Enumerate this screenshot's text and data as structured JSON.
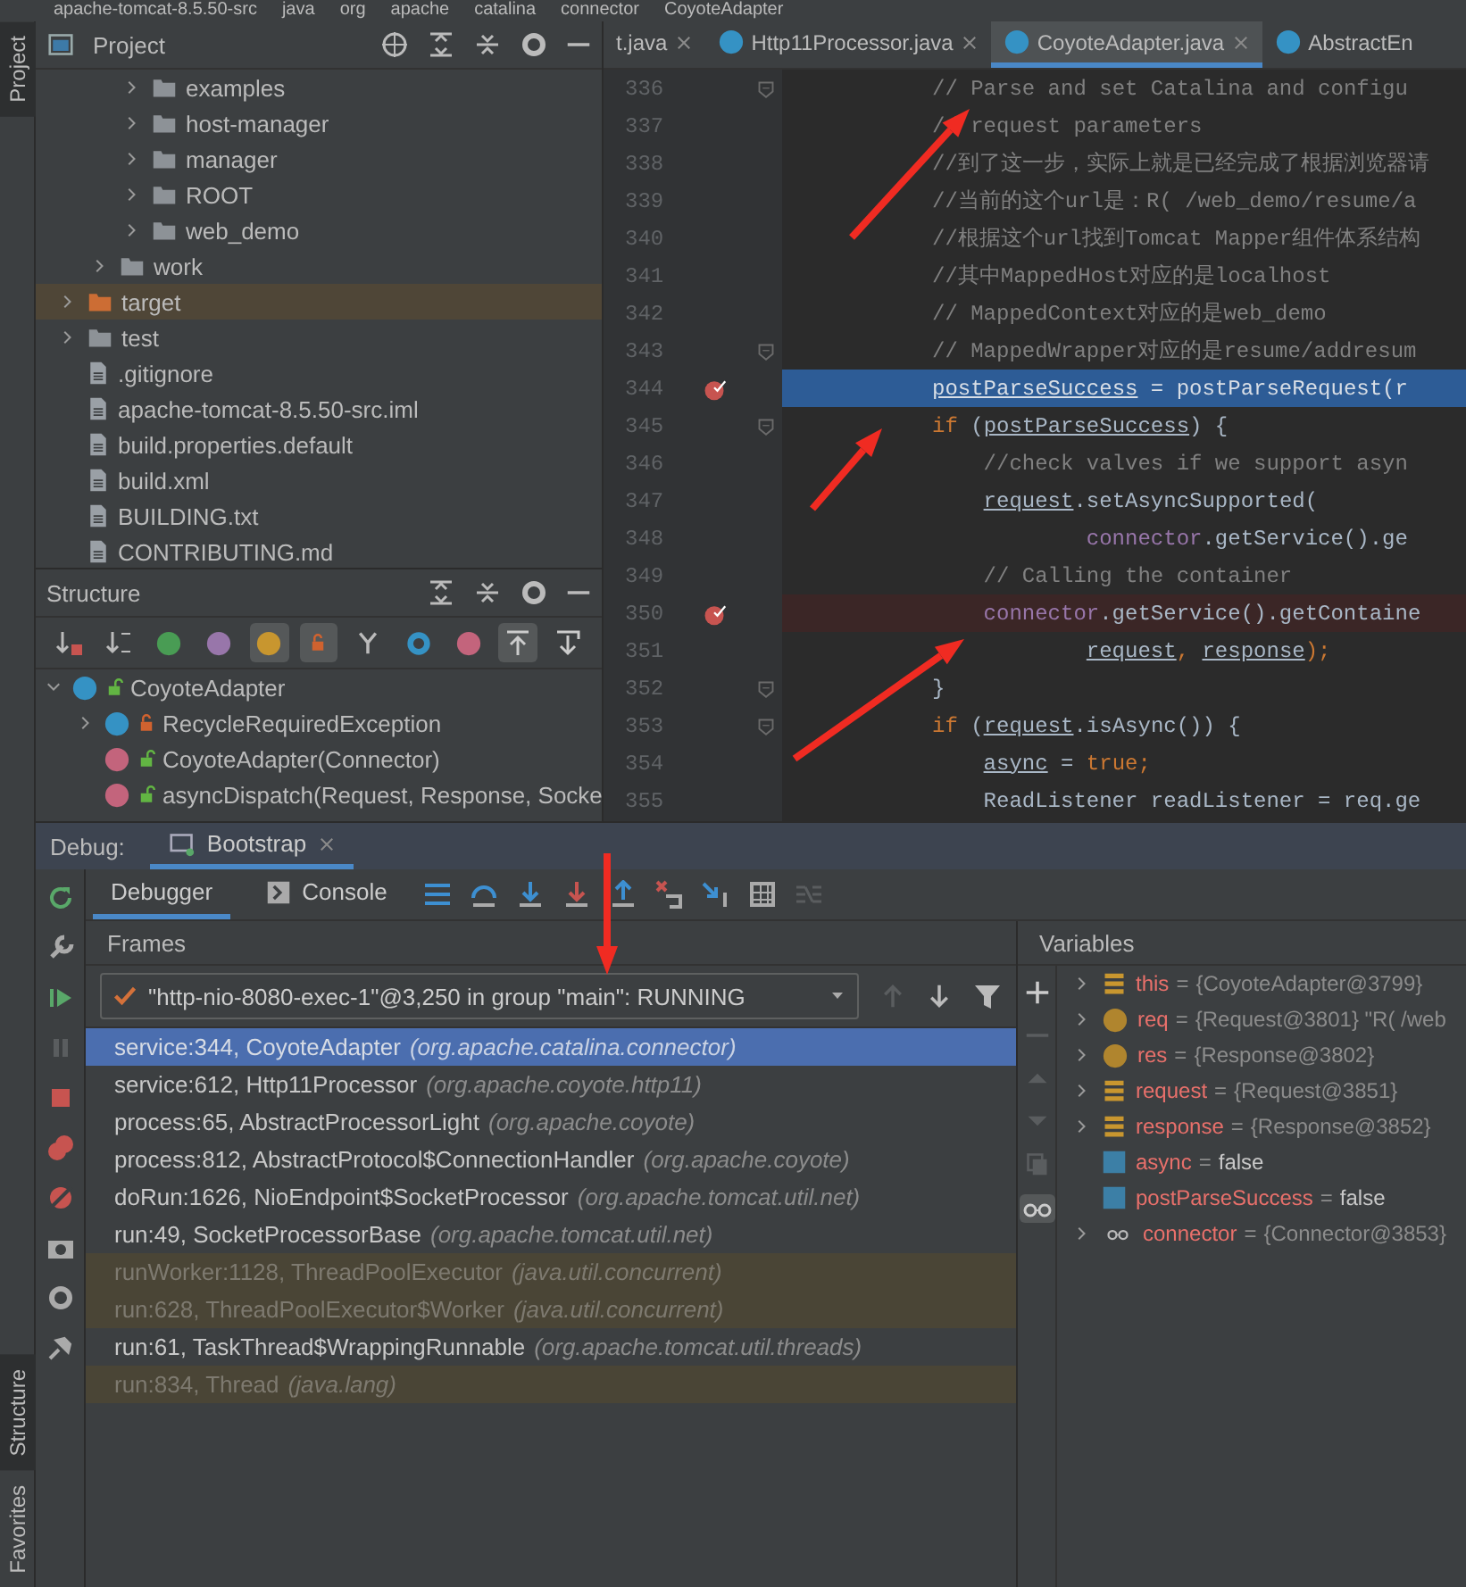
{
  "breadcrumb": [
    "apache-tomcat-8.5.50-src",
    "java",
    "org",
    "apache",
    "catalina",
    "connector",
    "CoyoteAdapter"
  ],
  "side_stripe": {
    "top": [
      {
        "label": "Project",
        "selected": true
      }
    ],
    "bottom": [
      {
        "label": "Structure",
        "selected": true
      },
      {
        "label": "Favorites",
        "selected": false
      }
    ]
  },
  "project": {
    "title": "Project",
    "tree": [
      {
        "children": [
          {
            "children": [
              {
                "label": "examples",
                "kind": "folder",
                "expanded": false,
                "highlighted": false
              },
              {
                "label": "host-manager",
                "kind": "folder",
                "expanded": false,
                "highlighted": false
              },
              {
                "label": "manager",
                "kind": "folder",
                "expanded": false,
                "highlighted": false
              },
              {
                "label": "ROOT",
                "kind": "folder",
                "expanded": false,
                "highlighted": false
              },
              {
                "label": "web_demo",
                "kind": "folder",
                "expanded": false,
                "highlighted": false
              }
            ]
          },
          {
            "label": "work",
            "kind": "folder",
            "expanded": false,
            "highlighted": false
          }
        ]
      },
      {
        "label": "target",
        "kind": "excluded-folder",
        "expanded": false,
        "highlighted": true
      },
      {
        "label": "test",
        "kind": "folder",
        "expanded": false,
        "highlighted": false
      },
      {
        "label": ".gitignore",
        "kind": "file",
        "highlighted": false
      },
      {
        "label": "apache-tomcat-8.5.50-src.iml",
        "kind": "file",
        "highlighted": false
      },
      {
        "label": "build.properties.default",
        "kind": "file",
        "highlighted": false
      },
      {
        "label": "build.xml",
        "kind": "file",
        "highlighted": false
      },
      {
        "label": "BUILDING.txt",
        "kind": "file",
        "highlighted": false
      },
      {
        "label": "CONTRIBUTING.md",
        "kind": "file",
        "highlighted": false
      }
    ]
  },
  "structure": {
    "title": "Structure",
    "toolbar": [
      {
        "kind": "sort-visibility",
        "on": false
      },
      {
        "kind": "sort-alpha",
        "on": false
      },
      {
        "kind": "inherited",
        "on": false
      },
      {
        "kind": "properties",
        "on": false
      },
      {
        "kind": "fields",
        "on": true
      },
      {
        "kind": "non-public",
        "on": true
      },
      {
        "kind": "anonymous",
        "on": false
      },
      {
        "kind": "lambdas",
        "on": false
      },
      {
        "kind": "lambda",
        "on": false
      },
      {
        "kind": "autoscroll-to",
        "on": true
      },
      {
        "kind": "autoscroll-from",
        "on": false
      }
    ],
    "tree": [
      {
        "label": "CoyoteAdapter",
        "kind": "class",
        "private": false,
        "expanded": true,
        "children": [
          {
            "label": "RecycleRequiredException",
            "kind": "class",
            "private": true,
            "expanded": false
          },
          {
            "label": "CoyoteAdapter(Connector)",
            "kind": "method",
            "private": false
          },
          {
            "label": "asyncDispatch(Request, Response, Socke",
            "kind": "method",
            "private": false
          }
        ]
      }
    ]
  },
  "editor": {
    "tabs": [
      {
        "label": "t.java",
        "selected": false,
        "icon": false,
        "closable": true
      },
      {
        "label": "Http11Processor.java",
        "selected": false,
        "icon": true,
        "closable": true
      },
      {
        "label": "CoyoteAdapter.java",
        "selected": true,
        "icon": true,
        "closable": true
      },
      {
        "label": "AbstractEn",
        "selected": false,
        "icon": true,
        "closable": false
      }
    ],
    "lines": [
      {
        "number": "336",
        "breakpoint": false,
        "current": false,
        "fold_marker": true,
        "tokens": [
          {
            "kind": "comment",
            "text": "// Parse and set Catalina and configu"
          }
        ]
      },
      {
        "number": "337",
        "breakpoint": false,
        "current": false,
        "fold_marker": false,
        "tokens": [
          {
            "kind": "comment",
            "text": "// request parameters"
          }
        ]
      },
      {
        "number": "338",
        "breakpoint": false,
        "current": false,
        "fold_marker": false,
        "tokens": [
          {
            "kind": "comment",
            "text": "//到了这一步，实际上就是已经完成了根据浏览器请"
          }
        ]
      },
      {
        "number": "339",
        "breakpoint": false,
        "current": false,
        "fold_marker": false,
        "tokens": [
          {
            "kind": "comment",
            "text": "//当前的这个url是：R( /web_demo/resume/a"
          }
        ]
      },
      {
        "number": "340",
        "breakpoint": false,
        "current": false,
        "fold_marker": false,
        "tokens": [
          {
            "kind": "comment",
            "text": "//根据这个url找到Tomcat Mapper组件体系结构"
          }
        ]
      },
      {
        "number": "341",
        "breakpoint": false,
        "current": false,
        "fold_marker": false,
        "tokens": [
          {
            "kind": "comment",
            "text": "//其中MappedHost对应的是localhost"
          }
        ]
      },
      {
        "number": "342",
        "breakpoint": false,
        "current": false,
        "fold_marker": false,
        "tokens": [
          {
            "kind": "comment",
            "text": "// MappedContext对应的是web_demo"
          }
        ]
      },
      {
        "number": "343",
        "breakpoint": false,
        "current": false,
        "fold_marker": true,
        "tokens": [
          {
            "kind": "comment",
            "text": "// MappedWrapper对应的是resume/addresum"
          }
        ]
      },
      {
        "number": "344",
        "breakpoint": true,
        "current": true,
        "fold_marker": false,
        "tokens": [
          {
            "kind": "var",
            "text": "postParseSuccess"
          },
          {
            "kind": "plain",
            "text": " = postParseRequest(r"
          }
        ]
      },
      {
        "number": "345",
        "breakpoint": false,
        "current": false,
        "fold_marker": true,
        "tokens": [
          {
            "kind": "keyword",
            "text": "if"
          },
          {
            "kind": "plain",
            "text": " ("
          },
          {
            "kind": "var",
            "text": "postParseSuccess"
          },
          {
            "kind": "plain",
            "text": ") {"
          }
        ],
        "children": [
          {
            "number": "346",
            "kind": "statement",
            "breakpoint": false,
            "current": false,
            "fold_marker": false,
            "tokens": [
              {
                "kind": "comment",
                "text": "//check valves if we support asyn"
              }
            ]
          },
          {
            "number": "347",
            "kind": "statement",
            "breakpoint": false,
            "current": false,
            "fold_marker": false,
            "tokens": [
              {
                "kind": "var",
                "text": "request"
              },
              {
                "kind": "plain",
                "text": ".setAsyncSupported("
              }
            ],
            "children": [
              {
                "number": "348",
                "kind": "continuation",
                "breakpoint": false,
                "current": false,
                "fold_marker": false,
                "tokens": [
                  {
                    "kind": "field",
                    "text": "connector"
                  },
                  {
                    "kind": "plain",
                    "text": ".getService().ge"
                  }
                ]
              }
            ]
          },
          {
            "number": "349",
            "kind": "statement",
            "breakpoint": false,
            "current": false,
            "fold_marker": false,
            "tokens": [
              {
                "kind": "comment",
                "text": "// Calling the container"
              }
            ]
          },
          {
            "number": "350",
            "kind": "statement",
            "breakpoint": true,
            "current": false,
            "fold_marker": false,
            "tokens": [
              {
                "kind": "field",
                "text": "connector"
              },
              {
                "kind": "plain",
                "text": ".getService().getContaine"
              }
            ],
            "children": [
              {
                "number": "351",
                "kind": "continuation",
                "breakpoint": false,
                "current": false,
                "fold_marker": false,
                "tokens": [
                  {
                    "kind": "var",
                    "text": "request"
                  },
                  {
                    "kind": "punct",
                    "text": ", "
                  },
                  {
                    "kind": "var",
                    "text": "response"
                  },
                  {
                    "kind": "punct",
                    "text": ");"
                  }
                ]
              }
            ]
          }
        ]
      },
      {
        "number": "352",
        "breakpoint": false,
        "current": false,
        "fold_marker": true,
        "tokens": [
          {
            "kind": "plain",
            "text": "}"
          }
        ]
      },
      {
        "number": "353",
        "breakpoint": false,
        "current": false,
        "fold_marker": true,
        "tokens": [
          {
            "kind": "keyword",
            "text": "if"
          },
          {
            "kind": "plain",
            "text": " ("
          },
          {
            "kind": "var",
            "text": "request"
          },
          {
            "kind": "plain",
            "text": ".isAsync()) {"
          }
        ],
        "children": [
          {
            "number": "354",
            "kind": "statement",
            "breakpoint": false,
            "current": false,
            "fold_marker": false,
            "tokens": [
              {
                "kind": "var",
                "text": "async"
              },
              {
                "kind": "plain",
                "text": " = "
              },
              {
                "kind": "keyword",
                "text": "true"
              },
              {
                "kind": "punct",
                "text": ";"
              }
            ]
          },
          {
            "number": "355",
            "kind": "statement",
            "breakpoint": false,
            "current": false,
            "fold_marker": false,
            "tokens": [
              {
                "kind": "plain",
                "text": "ReadListener readListener = req.ge"
              }
            ]
          }
        ]
      }
    ]
  },
  "debug": {
    "label": "Debug:",
    "tabs": [
      {
        "label": "Bootstrap",
        "selected": true
      }
    ],
    "subtabs": [
      {
        "label": "Debugger",
        "selected": true
      },
      {
        "label": "Console",
        "selected": false
      }
    ],
    "frames": {
      "title": "Frames",
      "thread": "\"http-nio-8080-exec-1\"@3,250 in group \"main\": RUNNING",
      "items": [
        {
          "method": "service:344, CoyoteAdapter",
          "package": "(org.apache.catalina.connector)",
          "selected": true,
          "library": false
        },
        {
          "method": "service:612, Http11Processor",
          "package": "(org.apache.coyote.http11)",
          "selected": false,
          "library": false
        },
        {
          "method": "process:65, AbstractProcessorLight",
          "package": "(org.apache.coyote)",
          "selected": false,
          "library": false
        },
        {
          "method": "process:812, AbstractProtocol$ConnectionHandler",
          "package": "(org.apache.coyote)",
          "selected": false,
          "library": false
        },
        {
          "method": "doRun:1626, NioEndpoint$SocketProcessor",
          "package": "(org.apache.tomcat.util.net)",
          "selected": false,
          "library": false
        },
        {
          "method": "run:49, SocketProcessorBase",
          "package": "(org.apache.tomcat.util.net)",
          "selected": false,
          "library": false
        },
        {
          "method": "runWorker:1128, ThreadPoolExecutor",
          "package": "(java.util.concurrent)",
          "selected": false,
          "library": true
        },
        {
          "method": "run:628, ThreadPoolExecutor$Worker",
          "package": "(java.util.concurrent)",
          "selected": false,
          "library": true
        },
        {
          "method": "run:61, TaskThread$WrappingRunnable",
          "package": "(org.apache.tomcat.util.threads)",
          "selected": false,
          "library": false
        },
        {
          "method": "run:834, Thread",
          "package": "(java.lang)",
          "selected": false,
          "library": true
        }
      ]
    },
    "variables": {
      "title": "Variables",
      "items": [
        {
          "name": "this",
          "operator": "=",
          "value": "{CoyoteAdapter@3799}",
          "kind": "field",
          "expandable": true
        },
        {
          "name": "req",
          "operator": "=",
          "value": "{Request@3801} \"R( /web",
          "kind": "param",
          "expandable": true
        },
        {
          "name": "res",
          "operator": "=",
          "value": "{Response@3802}",
          "kind": "param",
          "expandable": true
        },
        {
          "name": "request",
          "operator": "=",
          "value": "{Request@3851}",
          "kind": "field",
          "expandable": true
        },
        {
          "name": "response",
          "operator": "=",
          "value": "{Response@3852}",
          "kind": "field",
          "expandable": true
        },
        {
          "name": "async",
          "operator": "=",
          "value": "false",
          "kind": "local",
          "expandable": false
        },
        {
          "name": "postParseSuccess",
          "operator": "=",
          "value": "false",
          "kind": "local",
          "expandable": false
        },
        {
          "name": "connector",
          "operator": "=",
          "value": "{Connector@3853}",
          "kind": "watch",
          "expandable": true
        }
      ]
    }
  }
}
